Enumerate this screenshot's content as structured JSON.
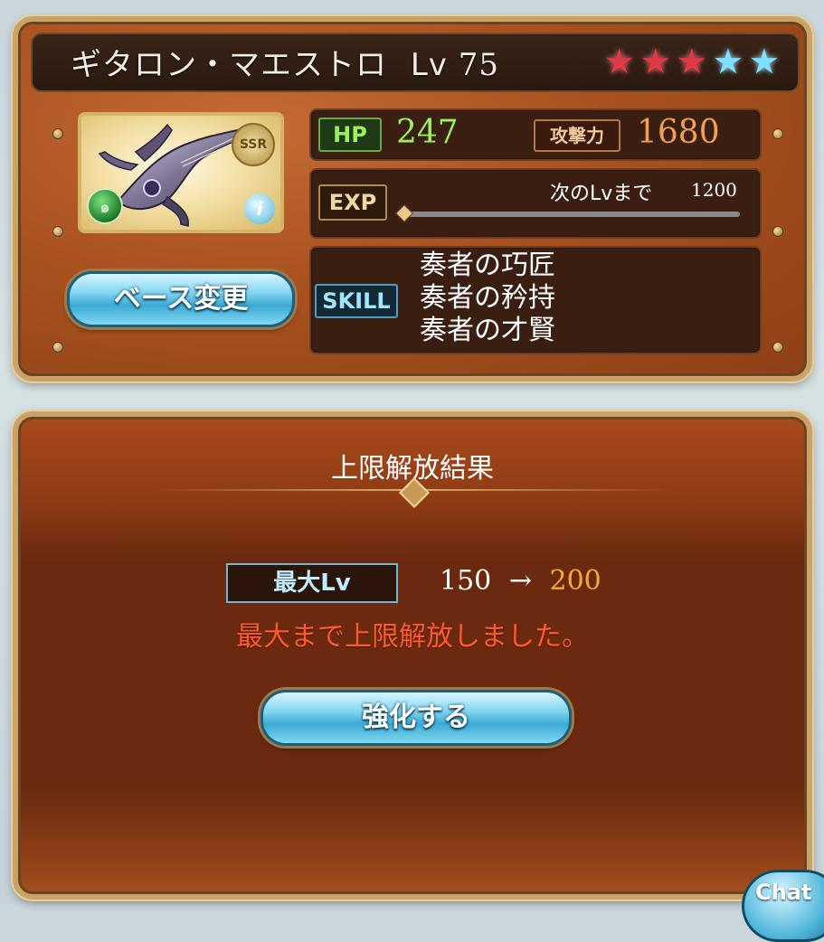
{
  "header": {
    "name": "ギタロン・マエストロ",
    "level_prefix": "Lv",
    "level": "75",
    "stars": [
      {
        "type": "red",
        "glyph": "★"
      },
      {
        "type": "red",
        "glyph": "★"
      },
      {
        "type": "red",
        "glyph": "★"
      },
      {
        "type": "blue",
        "glyph": "★"
      },
      {
        "type": "blue",
        "glyph": "★"
      }
    ],
    "star_colors": {
      "red": "#e23a44",
      "blue": "#7fe0ff"
    }
  },
  "portrait": {
    "rarity": "SSR",
    "element_icon": "wind-element-icon",
    "element_glyph": "๑",
    "info_glyph": "i"
  },
  "stats": {
    "hp_label": "HP",
    "hp_value": "247",
    "atk_label": "攻撃力",
    "atk_value": "1680",
    "exp_label": "EXP",
    "next_level_text": "次のLvまで",
    "next_level_value": "1200",
    "exp_progress": 0.0
  },
  "skills": {
    "label": "SKILL",
    "items": [
      "奏者の巧匠",
      "奏者の矜持",
      "奏者の才賢"
    ]
  },
  "buttons": {
    "change_base": "ベース変更",
    "enhance": "強化する",
    "chat": "Chat"
  },
  "result": {
    "title": "上限解放結果",
    "max_lv_label": "最大Lv",
    "from": "150",
    "arrow": "→",
    "to": "200",
    "message": "最大まで上限解放しました。"
  },
  "colors": {
    "hp": "#9cf060",
    "attack": "#f0a050",
    "new_level": "#f3a83a",
    "message": "#ff5a2d"
  }
}
